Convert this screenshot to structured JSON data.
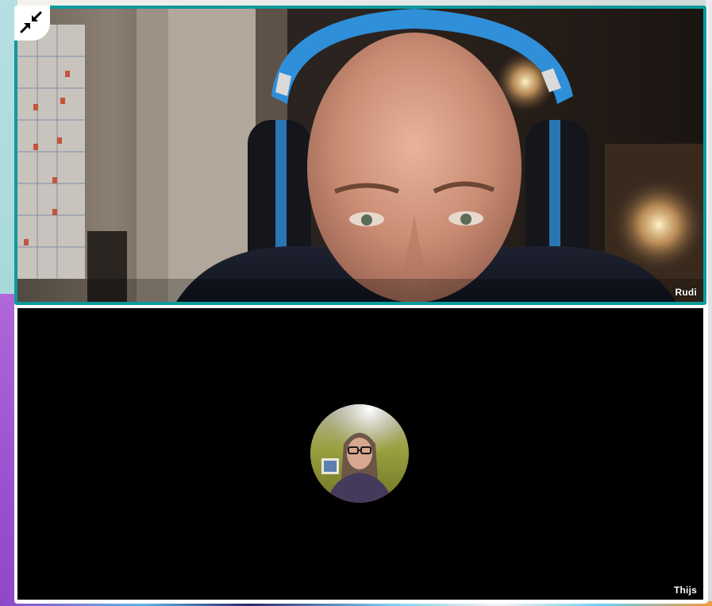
{
  "call": {
    "participants": [
      {
        "name": "Rudi",
        "video": "on",
        "active_speaker": true
      },
      {
        "name": "Thijs",
        "video": "off"
      }
    ],
    "controls": {
      "minimize_icon": "minimize-arrows-icon"
    }
  },
  "colors": {
    "active_speaker_border": "#0d9a9b",
    "tile_background": "#000000",
    "name_tag_text": "#ffffff"
  }
}
